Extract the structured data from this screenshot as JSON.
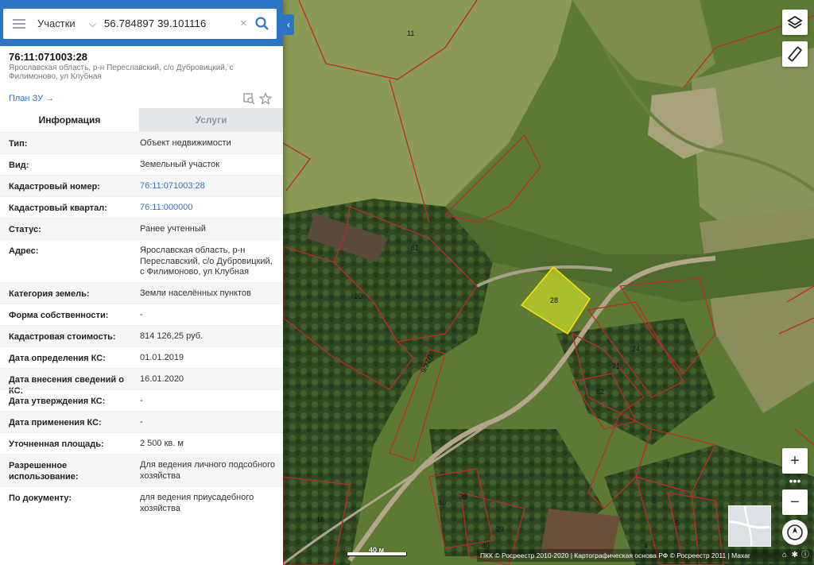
{
  "search": {
    "mode": "Участки",
    "query": "56.784897 39.101116"
  },
  "object": {
    "cadastral_number": "76:11:071003:28",
    "address": "Ярославская область, р-н Переславский, с/о Дубровицкий, с Филимоново, ул Клубная",
    "plan_link": "План ЗУ →"
  },
  "tabs": [
    {
      "label": "Информация",
      "active": true
    },
    {
      "label": "Услуги",
      "active": false
    }
  ],
  "info": [
    {
      "key": "Тип:",
      "value": "Объект недвижимости"
    },
    {
      "key": "Вид:",
      "value": "Земельный участок"
    },
    {
      "key": "Кадастровый номер:",
      "value": "76:11:071003:28"
    },
    {
      "key": "Кадастровый квартал:",
      "value": "76:11:000000"
    },
    {
      "key": "Статус:",
      "value": "Ранее учтенный"
    },
    {
      "key": "Адрес:",
      "value": "Ярославская область, р-н Переславский, с/о Дубровицкий, с Филимоново, ул Клубная"
    },
    {
      "key": "Категория земель:",
      "value": "Земли населённых пунктов"
    },
    {
      "key": "Форма собственности:",
      "value": "-"
    },
    {
      "key": "Кадастровая стоимость:",
      "value": "814 126,25 руб."
    },
    {
      "key": "Дата определения КС:",
      "value": "01.01.2019"
    },
    {
      "key": "Дата внесения сведений о КС:",
      "value": "16.01.2020"
    },
    {
      "key": "Дата утверждения КС:",
      "value": "-"
    },
    {
      "key": "Дата применения КС:",
      "value": "-"
    },
    {
      "key": "Уточненная площадь:",
      "value": "2 500 кв. м"
    },
    {
      "key": "Разрешенное использование:",
      "value": "Для ведения личного подсобного хозяйства"
    },
    {
      "key": "По документу:",
      "value": "для ведения приусадебного хозяйства"
    }
  ],
  "map": {
    "parcel_labels": [
      "11",
      "61",
      "20",
      "28",
      "24",
      "71",
      "82",
      "9/27/1",
      "7",
      "6",
      "6",
      "40",
      "39",
      "16",
      "29",
      "40",
      "4"
    ],
    "selected_parcel": "28",
    "scale_label": "40 м",
    "attribution": "ПКК © Росреестр 2010-2020 | Картографическая основа РФ © Росреестр 2011 | Махаr",
    "colors": {
      "parcel_border": "#c0282d",
      "selected_fill": "#c6d62a",
      "accent": "#2d74c4"
    },
    "controls": [
      "layers-icon",
      "ruler-icon",
      "zoom-in-icon",
      "more-icon",
      "zoom-out-icon",
      "compass-icon"
    ]
  }
}
